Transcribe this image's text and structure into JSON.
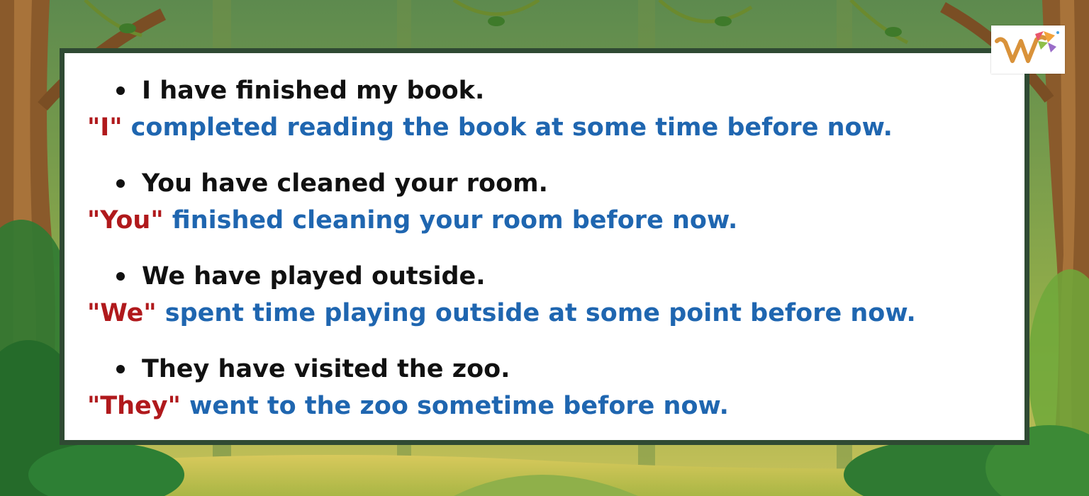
{
  "examples": [
    {
      "sentence": "I have finished my book.",
      "subject": "\"I\"",
      "explanation": " completed reading the book at some time before now."
    },
    {
      "sentence": "You have cleaned your room.",
      "subject": "\"You\"",
      "explanation": " finished cleaning your room before now."
    },
    {
      "sentence": "We have played outside.",
      "subject": "\"We\"",
      "explanation": " spent time playing outside at some point before now."
    },
    {
      "sentence": "They have visited the zoo.",
      "subject": "\"They\"",
      "explanation": " went to the zoo sometime before now."
    }
  ],
  "colors": {
    "subject": "#b0191c",
    "explanation": "#1f66b0",
    "sentence": "#111111",
    "frame": "#2f4a33"
  },
  "logo": {
    "icon": "brand-logo-icon"
  }
}
